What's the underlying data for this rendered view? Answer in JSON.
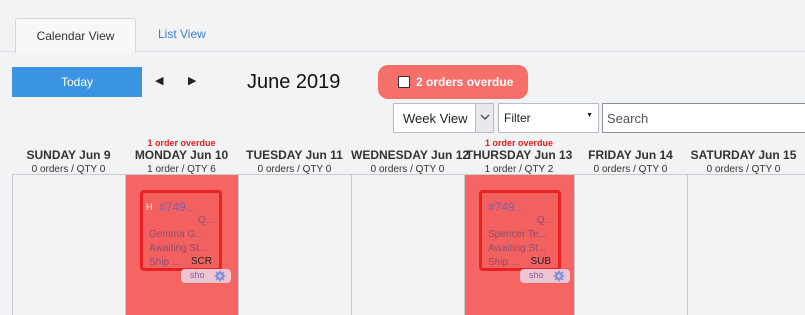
{
  "tabs": {
    "calendar_view": "Calendar View",
    "list_view": "List View"
  },
  "toolbar": {
    "today_label": "Today",
    "prev_glyph": "◀",
    "next_glyph": "▶",
    "month_title": "June 2019",
    "overdue_button": "2 orders overdue",
    "view_select": "Week View",
    "filter_select": "Filter",
    "search_placeholder": "Search"
  },
  "colors": {
    "accent": "#3b94e3",
    "overdue": "#f56563",
    "overdue_text": "#e31d1d"
  },
  "days": [
    {
      "overdue": "",
      "name": "SUNDAY Jun 9",
      "meta": "0 orders / QTY 0"
    },
    {
      "overdue": "1 order overdue",
      "name": "MONDAY Jun 10",
      "meta": "1 order / QTY 6"
    },
    {
      "overdue": "",
      "name": "TUESDAY Jun 11",
      "meta": "0 orders / QTY 0"
    },
    {
      "overdue": "",
      "name": "WEDNESDAY Jun 12",
      "meta": "0 orders / QTY 0"
    },
    {
      "overdue": "1 order overdue",
      "name": "THURSDAY Jun 13",
      "meta": "1 order / QTY 2"
    },
    {
      "overdue": "",
      "name": "FRIDAY Jun 14",
      "meta": "0 orders / QTY 0"
    },
    {
      "overdue": "",
      "name": "SATURDAY Jun 15",
      "meta": "0 orders / QTY 0"
    }
  ],
  "orders": [
    {
      "flag": "H",
      "number": "#749...",
      "qty": "Q...",
      "customer": "Gemma G...",
      "status": "Awaiting St...",
      "ship": "Ship ...",
      "tag": "SCR",
      "chip_label": "sho",
      "chip_icon": "gear-icon"
    },
    {
      "flag": "",
      "number": "#749...",
      "qty": "Q...",
      "customer": "Spencer Te...",
      "status": "Awaiting St...",
      "ship": "Ship ...",
      "tag": "SUB",
      "chip_label": "sho",
      "chip_icon": "gear-icon"
    }
  ]
}
